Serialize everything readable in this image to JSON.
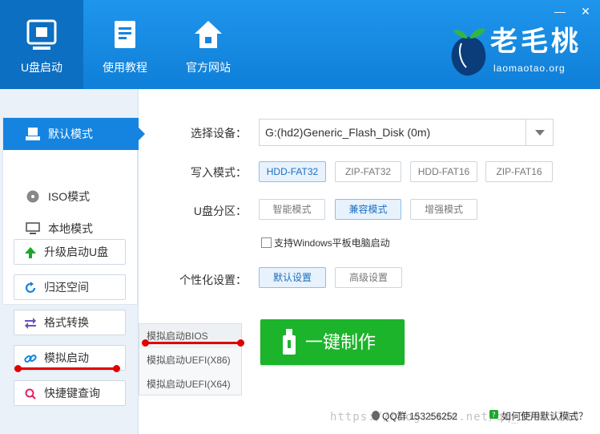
{
  "header": {
    "nav": [
      {
        "label": "U盘启动",
        "icon": "usb-drive-icon",
        "active": true
      },
      {
        "label": "使用教程",
        "icon": "book-icon",
        "active": false
      },
      {
        "label": "官方网站",
        "icon": "home-icon",
        "active": false
      }
    ],
    "window_controls": {
      "minimize": "—",
      "close": "✕"
    },
    "logo": {
      "title": "老毛桃",
      "subtitle": "laomaotao.org"
    }
  },
  "sidebar": {
    "modes": [
      {
        "label": "默认模式",
        "icon": "usb-drive-icon",
        "active": true
      },
      {
        "label": "ISO模式",
        "icon": "disc-icon",
        "active": false
      },
      {
        "label": "本地模式",
        "icon": "monitor-icon",
        "active": false
      }
    ],
    "tools": [
      {
        "label": "升级启动U盘",
        "icon": "arrow-up-icon"
      },
      {
        "label": "归还空间",
        "icon": "refresh-icon"
      },
      {
        "label": "格式转换",
        "icon": "convert-arrows-icon"
      },
      {
        "label": "模拟启动",
        "icon": "link-icon"
      },
      {
        "label": "快捷键查询",
        "icon": "search-icon"
      }
    ],
    "sim_menu": [
      "模拟启动BIOS",
      "模拟启动UEFI(X86)",
      "模拟启动UEFI(X64)"
    ]
  },
  "main": {
    "device": {
      "label": "选择设备：",
      "value": "G:(hd2)Generic_Flash_Disk (0m)"
    },
    "write_mode": {
      "label": "写入模式：",
      "options": [
        "HDD-FAT32",
        "ZIP-FAT32",
        "HDD-FAT16",
        "ZIP-FAT16"
      ],
      "selected": "HDD-FAT32"
    },
    "partition": {
      "label": "U盘分区：",
      "options": [
        "智能模式",
        "兼容模式",
        "增强模式"
      ],
      "selected": "兼容模式"
    },
    "windows_tablet": {
      "label": "支持Windows平板电脑启动",
      "checked": false
    },
    "personalize": {
      "label": "个性化设置：",
      "options": [
        "默认设置",
        "高级设置"
      ],
      "selected": "默认设置"
    },
    "make_button": "一键制作"
  },
  "footer": {
    "qq": "QQ群 153256252",
    "help": "如何使用默认模式？",
    "watermark": "https://blog.csdn.net/qq_35923749"
  },
  "colors": {
    "header": "#1584e0",
    "accent_green": "#1cb42a",
    "annotation_red": "#e00000"
  }
}
